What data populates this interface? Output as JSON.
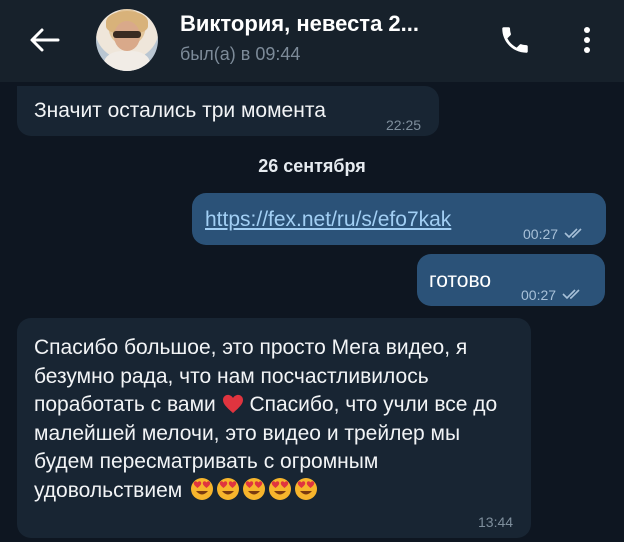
{
  "header": {
    "contact_name": "Виктория, невеста 2...",
    "status": "был(а) в 09:44",
    "icons": [
      "back-arrow-icon",
      "avatar",
      "phone-icon",
      "more-vertical-icon"
    ]
  },
  "colors": {
    "background": "#0e1621",
    "header": "#17212b",
    "incoming_bubble": "#182533",
    "outgoing_bubble": "#2b5278",
    "link": "#a2cff4"
  },
  "messages": [
    {
      "direction": "in",
      "text": "Значит остались три момента",
      "time": "22:25"
    },
    {
      "direction": "out",
      "text": "https://fex.net/ru/s/efo7kak",
      "is_link": true,
      "time": "00:27",
      "read": true
    },
    {
      "direction": "out",
      "text": "готово",
      "time": "00:27",
      "read": true
    },
    {
      "direction": "in",
      "text_part1": "Спасибо большое, это просто Мега видео, я безумно рада, что нам посчастливилось поработать с вами",
      "heart_emoji": "red-heart",
      "text_part2": "Спасибо, что учли все до малейшей мелочи, это видео и трейлер мы будем пересматривать с огромным удовольствием",
      "trailing_emoji": [
        "heart-eyes",
        "heart-eyes",
        "heart-eyes",
        "heart-eyes",
        "heart-eyes"
      ],
      "time": "13:44"
    }
  ],
  "date_separator": "26 сентября"
}
